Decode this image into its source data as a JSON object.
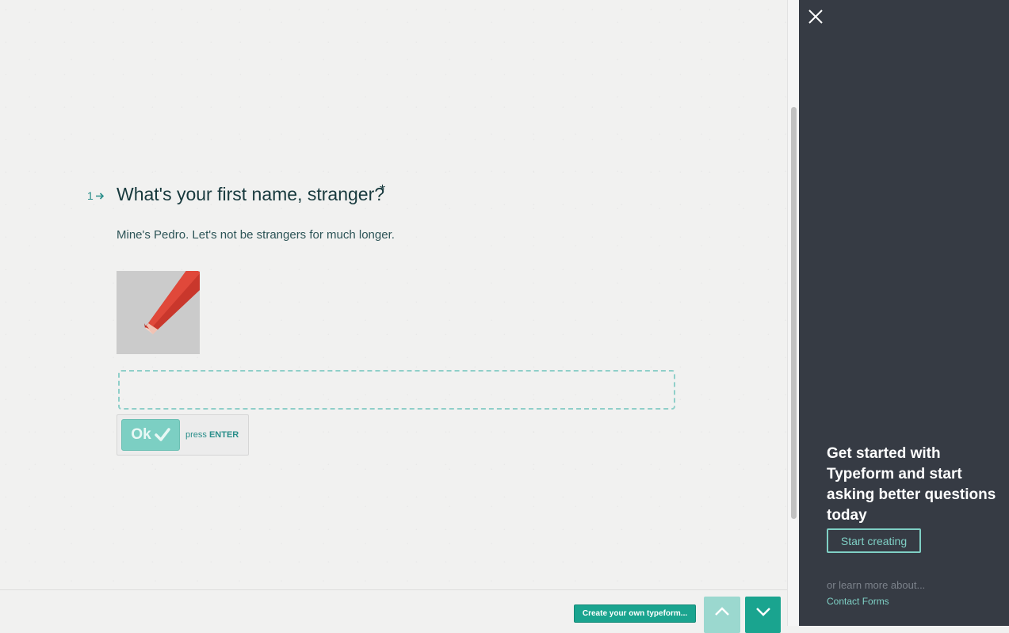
{
  "question": {
    "number": "1",
    "title": "What's your first name, stranger?",
    "required_mark": "*",
    "description": "Mine's Pedro. Let's not be strangers for much longer.",
    "image_icon": "pencil-icon",
    "answer_value": "",
    "ok_label": "Ok",
    "press_label": "press",
    "enter_label": "ENTER"
  },
  "bottom_bar": {
    "create_label": "Create your own typeform...",
    "up_icon": "chevron-up-icon",
    "down_icon": "chevron-down-icon"
  },
  "side_panel": {
    "close_icon": "close-icon",
    "heading": "Get started with Typeform and start asking better questions today",
    "start_button": "Start creating",
    "learn_more": "or learn more about...",
    "contact_link": "Contact Forms"
  },
  "colors": {
    "accent": "#1aa48f",
    "panel_bg": "#363b44",
    "title_text": "#17393d"
  }
}
